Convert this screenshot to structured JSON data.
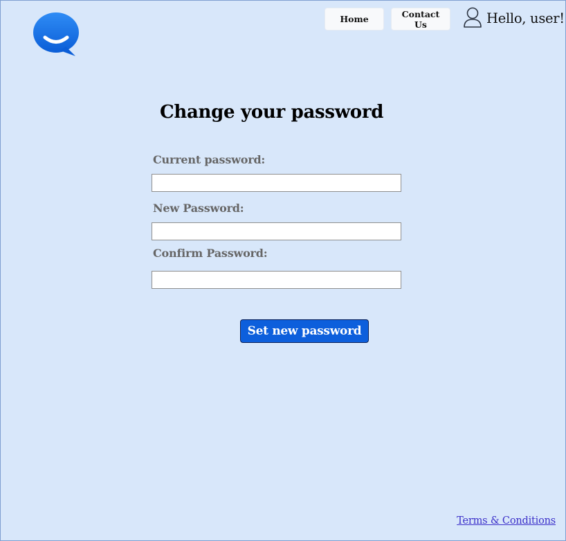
{
  "header": {
    "logo_icon": "chat-bubble-smile-icon",
    "nav": {
      "home_label": "Home",
      "contact_label": "Contact Us"
    },
    "user_icon": "user-outline-icon",
    "greeting": "Hello, user!"
  },
  "form": {
    "title": "Change your password",
    "fields": [
      {
        "label": "Current password:",
        "value": ""
      },
      {
        "label": "New Password:",
        "value": ""
      },
      {
        "label": "Confirm Password:",
        "value": ""
      }
    ],
    "submit_label": "Set new password"
  },
  "footer": {
    "terms_label": "Terms & Conditions"
  },
  "colors": {
    "page_background": "#d8e7fa",
    "primary_button": "#0d5fdc",
    "logo_blue": "#1a73e8",
    "label_gray": "#666666",
    "link": "#3b2fc9"
  }
}
